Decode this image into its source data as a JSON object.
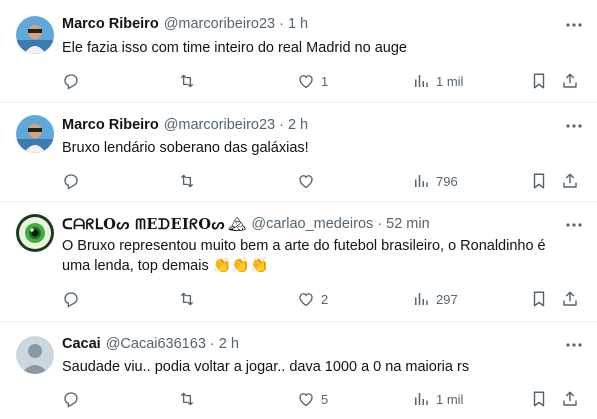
{
  "tweets": [
    {
      "name": "Marco Ribeiro",
      "handle": "@marcoribeiro23",
      "time": "1 h",
      "text": "Ele fazia isso com time inteiro do real Madrid no auge",
      "replies": "",
      "retweets": "",
      "likes": "1",
      "views": "1 mil",
      "avatar": "photo-avatar-icon"
    },
    {
      "name": "Marco Ribeiro",
      "handle": "@marcoribeiro23",
      "time": "2 h",
      "text": "Bruxo lendário soberano das galáxias!",
      "replies": "",
      "retweets": "",
      "likes": "",
      "views": "796",
      "avatar": "photo-avatar-icon"
    },
    {
      "name": "ᑕᗩᖇᒪOᔕ ᗰEᗪEIᖇOᔕ",
      "name_emoji": "🏔",
      "handle": "@carlao_medeiros",
      "time": "52 min",
      "text": "O Bruxo representou muito bem a arte do futebol brasileiro, o Ronaldinho é uma lenda, top demais",
      "text_emoji": "👏👏👏",
      "replies": "",
      "retweets": "",
      "likes": "2",
      "views": "297",
      "avatar": "eye-avatar-icon"
    },
    {
      "name": "Cacai",
      "handle": "@Cacai636163",
      "time": "2 h",
      "text": "Saudade viu.. podia voltar a jogar.. dava 1000 a 0 na maioria rs",
      "replies": "",
      "retweets": "",
      "likes": "5",
      "views": "1 mil",
      "avatar": "default-avatar-icon"
    }
  ],
  "separator": "·",
  "colors": {
    "text": "#0f1419",
    "secondary": "#536471",
    "border": "#eff3f4",
    "background": "#ffffff"
  }
}
